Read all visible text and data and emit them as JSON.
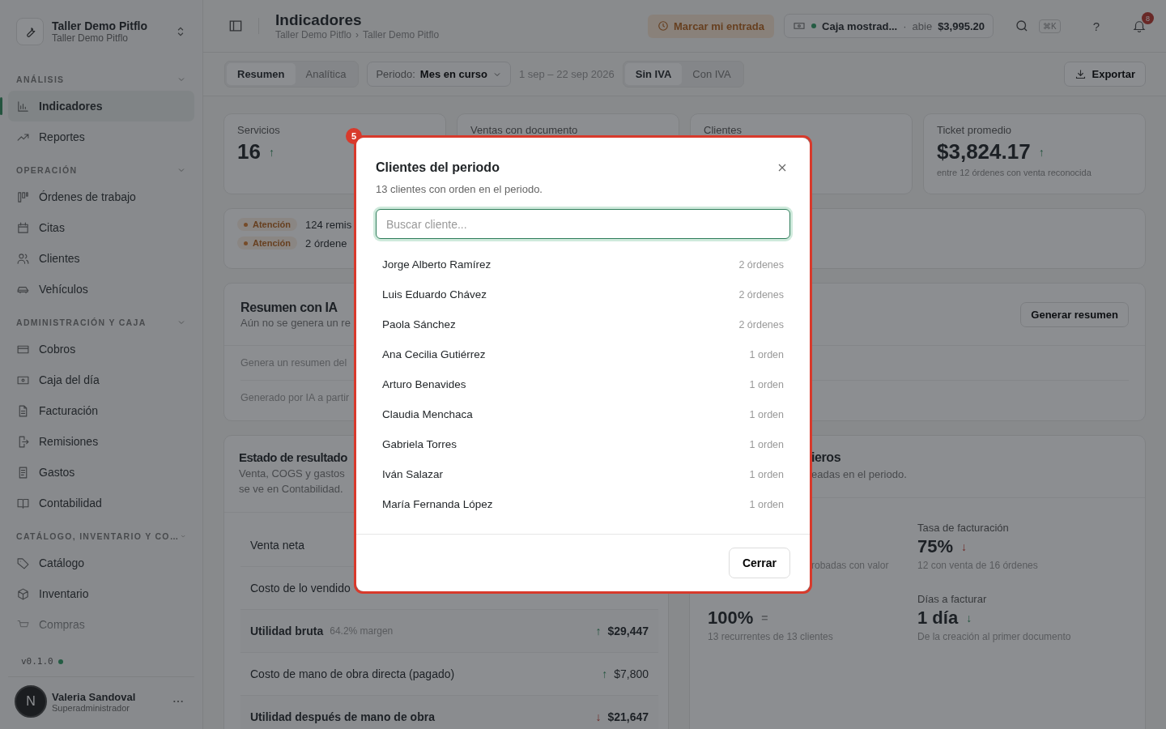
{
  "sidebar": {
    "org": {
      "name": "Taller Demo Pitflo",
      "subtitle": "Taller Demo Pitflo"
    },
    "sections": [
      {
        "title": "ANÁLISIS",
        "items": [
          {
            "label": "Indicadores",
            "selected": true
          },
          {
            "label": "Reportes",
            "selected": false
          }
        ]
      },
      {
        "title": "OPERACIÓN",
        "items": [
          {
            "label": "Órdenes de trabajo",
            "selected": false
          },
          {
            "label": "Citas",
            "selected": false
          },
          {
            "label": "Clientes",
            "selected": false
          },
          {
            "label": "Vehículos",
            "selected": false
          }
        ]
      },
      {
        "title": "ADMINISTRACIÓN Y CAJA",
        "items": [
          {
            "label": "Cobros",
            "selected": false
          },
          {
            "label": "Caja del día",
            "selected": false
          },
          {
            "label": "Facturación",
            "selected": false
          },
          {
            "label": "Remisiones",
            "selected": false
          },
          {
            "label": "Gastos",
            "selected": false
          },
          {
            "label": "Contabilidad",
            "selected": false
          }
        ]
      },
      {
        "title": "CATÁLOGO, INVENTARIO Y CO…",
        "items": [
          {
            "label": "Catálogo",
            "selected": false
          },
          {
            "label": "Inventario",
            "selected": false
          },
          {
            "label": "Compras",
            "selected": false
          }
        ]
      }
    ],
    "version": "v0.1.0",
    "user": {
      "initial": "N",
      "name": "Valeria Sandoval",
      "role": "Superadministrador"
    }
  },
  "header": {
    "title": "Indicadores",
    "breadcrumb": [
      "Taller Demo Pitflo",
      "Taller Demo Pitflo"
    ],
    "separator": "›",
    "clock_in": "Marcar mi entrada",
    "register": {
      "name": "Caja mostrad...",
      "dot": "·",
      "status": "abie",
      "amount": "$3,995.20"
    },
    "shortcut": "⌘K",
    "help": "?",
    "notifications": "8"
  },
  "toolbar": {
    "tabs": [
      {
        "label": "Resumen",
        "selected": true
      },
      {
        "label": "Analítica",
        "selected": false
      }
    ],
    "period_label": "Periodo:",
    "period_value": "Mes en curso",
    "date_range": "1 sep – 22 sep 2026",
    "tax_tabs": [
      {
        "label": "Sin IVA",
        "selected": true
      },
      {
        "label": "Con IVA",
        "selected": false
      }
    ],
    "export": "Exportar"
  },
  "kpis": [
    {
      "label": "Servicios",
      "value": "16",
      "trend": "↑",
      "favorable": true
    },
    {
      "label": "Ventas con documento"
    },
    {
      "label": "Clientes"
    },
    {
      "label": "Ticket promedio",
      "value": "$3,824.17",
      "trend": "↑",
      "favorable": true,
      "note": "entre 12 órdenes con venta reconocida"
    }
  ],
  "alerts": [
    {
      "badge": "Atención",
      "text": "124 remis"
    },
    {
      "badge": "Atención",
      "text": "2 órdene"
    }
  ],
  "ai_summary": {
    "title": "Resumen con IA",
    "description": "Aún no se genera un re",
    "button": "Generar resumen",
    "lines": [
      "Genera un resumen del",
      "Generado por IA a partir"
    ]
  },
  "income_statement": {
    "title": "Estado de resultado",
    "description": [
      "Venta, COGS y gastos",
      "se ve en Contabilidad."
    ],
    "rows": [
      {
        "label": "Venta neta",
        "emphasis": false
      },
      {
        "label": "Costo de lo vendido",
        "emphasis": false
      },
      {
        "label": "Utilidad bruta",
        "note": "64.2% margen",
        "value": "$29,447",
        "trend": "↑",
        "favorable": true,
        "emphasis": true
      },
      {
        "label": "Costo de mano de obra directa (pagado)",
        "value": "$7,800",
        "trend": "↑",
        "favorable": true,
        "emphasis": false
      },
      {
        "label": "Utilidad después de mano de obra",
        "value": "$21,647",
        "trend": "↓",
        "favorable": false,
        "emphasis": true
      }
    ]
  },
  "metrics_card": {
    "title": "ieros",
    "description": "eadas en el periodo.",
    "metrics": [
      {
        "note": "robadas con valor",
        "peek": true
      },
      {
        "label": "Tasa de facturación",
        "value": "75%",
        "trend": "↓",
        "favorable": false,
        "note": "12 con venta de 16 órdenes",
        "peek": false
      },
      {
        "value": "100%",
        "trend": "=",
        "note": "13 recurrentes de 13 clientes",
        "peek": false
      },
      {
        "label": "Días a facturar",
        "value": "1 día",
        "trend": "↓",
        "favorable": true,
        "note": "De la creación al primer documento",
        "peek": false
      }
    ]
  },
  "modal": {
    "title": "Clientes del periodo",
    "subtitle": "13 clientes con orden en el periodo.",
    "search": {
      "placeholder": "Buscar cliente..."
    },
    "clients": [
      {
        "name": "Jorge Alberto Ramírez",
        "orders": "2 órdenes"
      },
      {
        "name": "Luis Eduardo Chávez",
        "orders": "2 órdenes"
      },
      {
        "name": "Paola Sánchez",
        "orders": "2 órdenes"
      },
      {
        "name": "Ana Cecilia Gutiérrez",
        "orders": "1 orden"
      },
      {
        "name": "Arturo Benavides",
        "orders": "1 orden"
      },
      {
        "name": "Claudia Menchaca",
        "orders": "1 orden"
      },
      {
        "name": "Gabriela Torres",
        "orders": "1 orden"
      },
      {
        "name": "Iván Salazar",
        "orders": "1 orden"
      },
      {
        "name": "María Fernanda López",
        "orders": "1 orden"
      }
    ],
    "close": "Cerrar"
  },
  "annotation": {
    "badge": "5"
  }
}
